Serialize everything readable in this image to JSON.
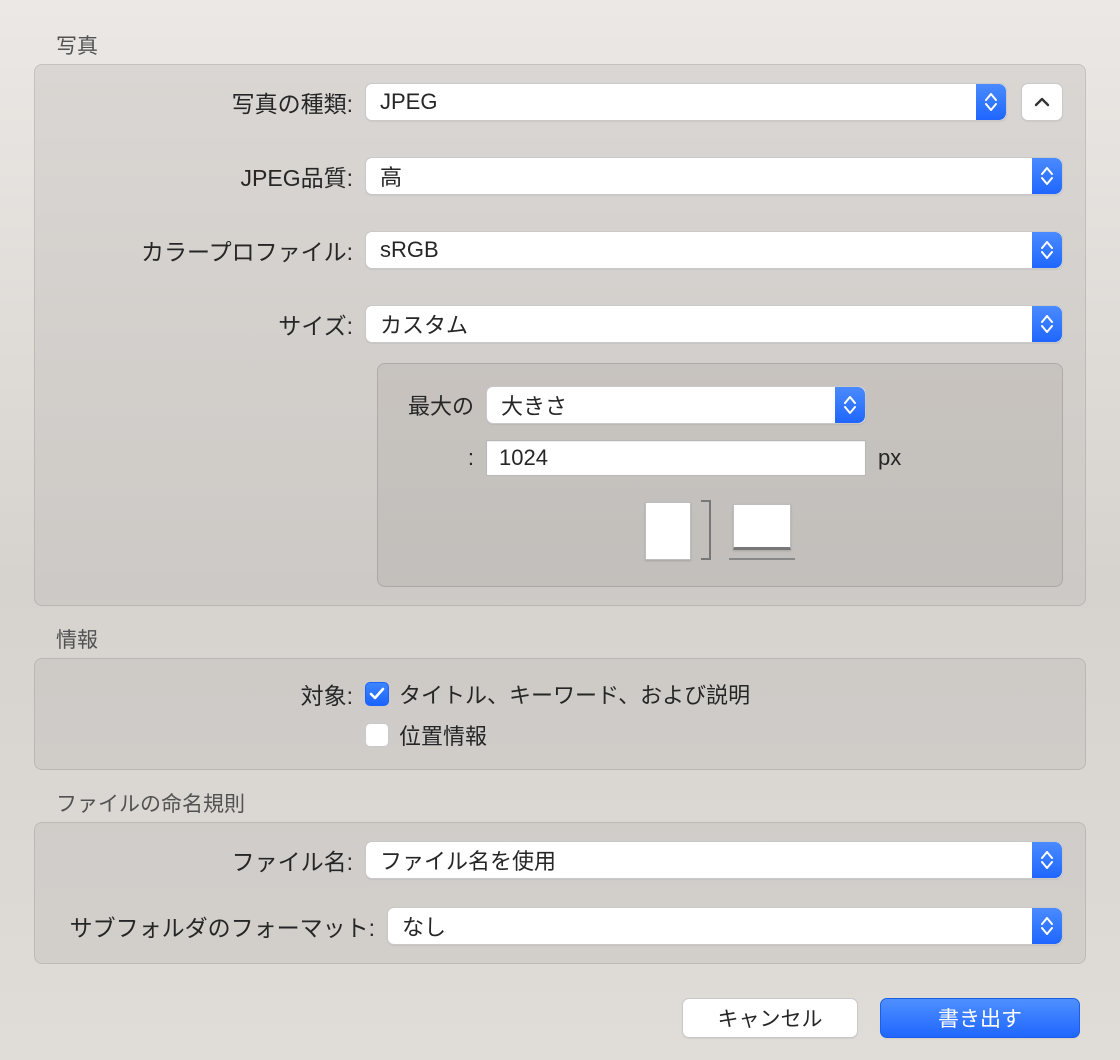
{
  "sections": {
    "photo": {
      "title": "写真",
      "kind_label": "写真の種類:",
      "kind_value": "JPEG",
      "quality_label": "JPEG品質:",
      "quality_value": "高",
      "profile_label": "カラープロファイル:",
      "profile_value": "sRGB",
      "size_label": "サイズ:",
      "size_value": "カスタム",
      "custom": {
        "max_label": "最大の",
        "dimension_value": "大きさ",
        "value": "1024",
        "unit": "px",
        "colon": ":"
      }
    },
    "info": {
      "title": "情報",
      "target_label": "対象:",
      "check1_label": "タイトル、キーワード、および説明",
      "check1_checked": true,
      "check2_label": "位置情報",
      "check2_checked": false
    },
    "naming": {
      "title": "ファイルの命名規則",
      "filename_label": "ファイル名:",
      "filename_value": "ファイル名を使用",
      "subfolder_label": "サブフォルダのフォーマット:",
      "subfolder_value": "なし"
    }
  },
  "buttons": {
    "cancel": "キャンセル",
    "export": "書き出す"
  }
}
